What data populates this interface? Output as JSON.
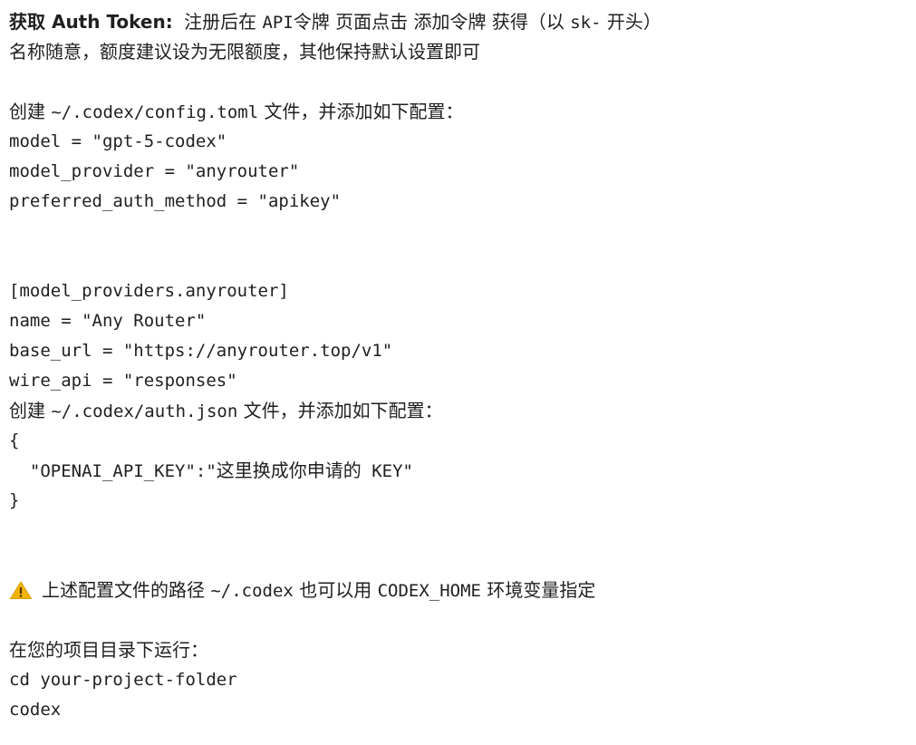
{
  "intro": {
    "title_bold": "获取 Auth Token:",
    "p1": "注册后在",
    "p2": "API",
    "p3": "令牌 页面点击",
    "p4": "添加令牌",
    "p5": "获得（以",
    "p6": "sk-",
    "p7": "开头）",
    "line2": "名称随意，额度建议设为无限额度，其他保持默认设置即可"
  },
  "config_toml": {
    "lead_pre": "创建",
    "path": "~/.codex/config.toml",
    "lead_post": "文件，并添加如下配置：",
    "lines": [
      "model = \"gpt-5-codex\"",
      "model_provider = \"anyrouter\"",
      "preferred_auth_method = \"apikey\""
    ],
    "section_lines": [
      "[model_providers.anyrouter]",
      "name = \"Any Router\"",
      "base_url = \"https://anyrouter.top/v1\"",
      "wire_api = \"responses\""
    ]
  },
  "auth_json": {
    "lead_pre": "创建",
    "path": "~/.codex/auth.json",
    "lead_post": "文件，并添加如下配置：",
    "open": "{",
    "key_mono": "  \"OPENAI_API_KEY\":\"",
    "key_value_cn": "这里换成你申请的",
    "key_tail": " KEY\"",
    "close": "}"
  },
  "note": {
    "icon": "warning-icon",
    "pre": "上述配置文件的路径",
    "path": "~/.codex",
    "mid": "也可以用",
    "env": "CODEX_HOME",
    "post": "环境变量指定"
  },
  "run": {
    "lead": "在您的项目目录下运行：",
    "cmd1": "cd your-project-folder",
    "cmd2": "codex"
  },
  "colors": {
    "text": "#1f1f1f",
    "warning_fill": "#f4b400",
    "warning_mark": "#4a3500"
  }
}
